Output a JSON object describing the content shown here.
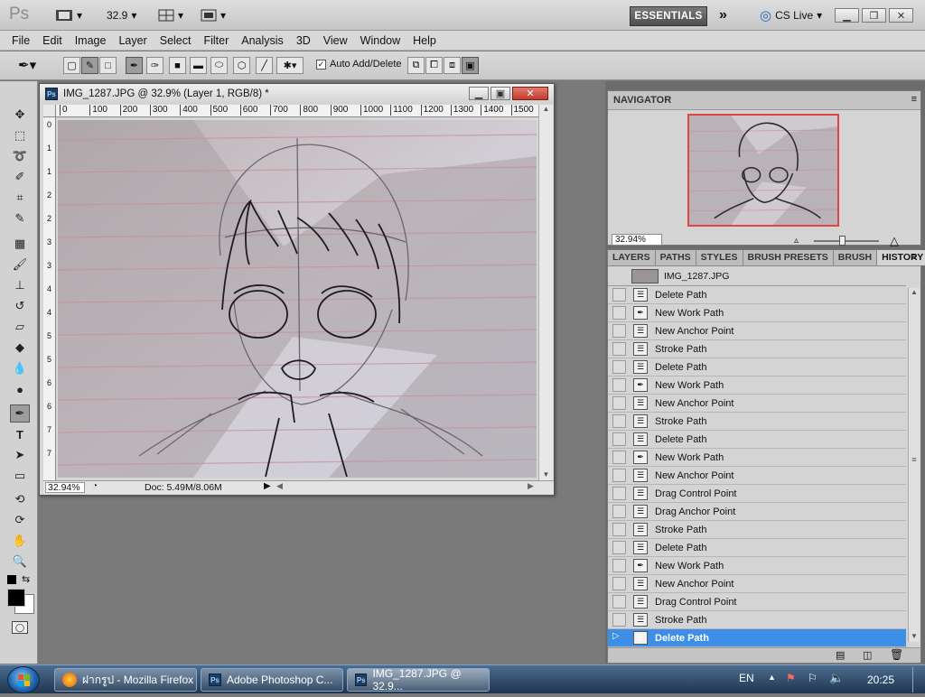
{
  "appbar": {
    "logo": "Ps",
    "zoom": "32.9",
    "workspace": "ESSENTIALS",
    "cslive": "CS Live",
    "more": "»"
  },
  "menu": [
    "File",
    "Edit",
    "Image",
    "Layer",
    "Select",
    "Filter",
    "Analysis",
    "3D",
    "View",
    "Window",
    "Help"
  ],
  "options": {
    "auto_add_delete": "Auto Add/Delete",
    "checked": "✓"
  },
  "document": {
    "title": "IMG_1287.JPG @ 32.9% (Layer 1, RGB/8) *",
    "ruler_h": [
      "0",
      "100",
      "200",
      "300",
      "400",
      "500",
      "600",
      "700",
      "800",
      "900",
      "1000",
      "1100",
      "1200",
      "1300",
      "1400",
      "1500"
    ],
    "ruler_v": [
      "0",
      "1",
      "1",
      "2",
      "2",
      "3",
      "3",
      "4",
      "4",
      "5",
      "5",
      "6",
      "6",
      "7",
      "7"
    ],
    "zoom": "32.94%",
    "doc_size": "Doc: 5.49M/8.06M"
  },
  "navigator": {
    "tab": "NAVIGATOR",
    "zoom": "32.94%"
  },
  "history": {
    "tabs": [
      "LAYERS",
      "PATHS",
      "STYLES",
      "BRUSH PRESETS",
      "BRUSH",
      "HISTORY"
    ],
    "snapshot": "IMG_1287.JPG",
    "items": [
      {
        "label": "Delete Path",
        "icon": "doc"
      },
      {
        "label": "New Work Path",
        "icon": "pen"
      },
      {
        "label": "New Anchor Point",
        "icon": "doc"
      },
      {
        "label": "Stroke Path",
        "icon": "doc"
      },
      {
        "label": "Delete Path",
        "icon": "doc"
      },
      {
        "label": "New Work Path",
        "icon": "pen"
      },
      {
        "label": "New Anchor Point",
        "icon": "doc"
      },
      {
        "label": "Stroke Path",
        "icon": "doc"
      },
      {
        "label": "Delete Path",
        "icon": "doc"
      },
      {
        "label": "New Work Path",
        "icon": "pen"
      },
      {
        "label": "New Anchor Point",
        "icon": "doc"
      },
      {
        "label": "Drag Control Point",
        "icon": "doc"
      },
      {
        "label": "Drag Anchor Point",
        "icon": "doc"
      },
      {
        "label": "Stroke Path",
        "icon": "doc"
      },
      {
        "label": "Delete Path",
        "icon": "doc"
      },
      {
        "label": "New Work Path",
        "icon": "pen"
      },
      {
        "label": "New Anchor Point",
        "icon": "doc"
      },
      {
        "label": "Drag Control Point",
        "icon": "doc"
      },
      {
        "label": "Stroke Path",
        "icon": "doc"
      },
      {
        "label": "Delete Path",
        "icon": "doc"
      }
    ],
    "selected_index": 19
  },
  "taskbar": {
    "tasks": [
      "ฝากรูป - Mozilla Firefox",
      "Adobe Photoshop C...",
      "IMG_1287.JPG @ 32.9..."
    ],
    "lang": "EN",
    "time": "20:25"
  },
  "colors": {
    "selection": "#3d8ee6",
    "nav_frame": "#e0444a",
    "close": "#c23b2f"
  }
}
